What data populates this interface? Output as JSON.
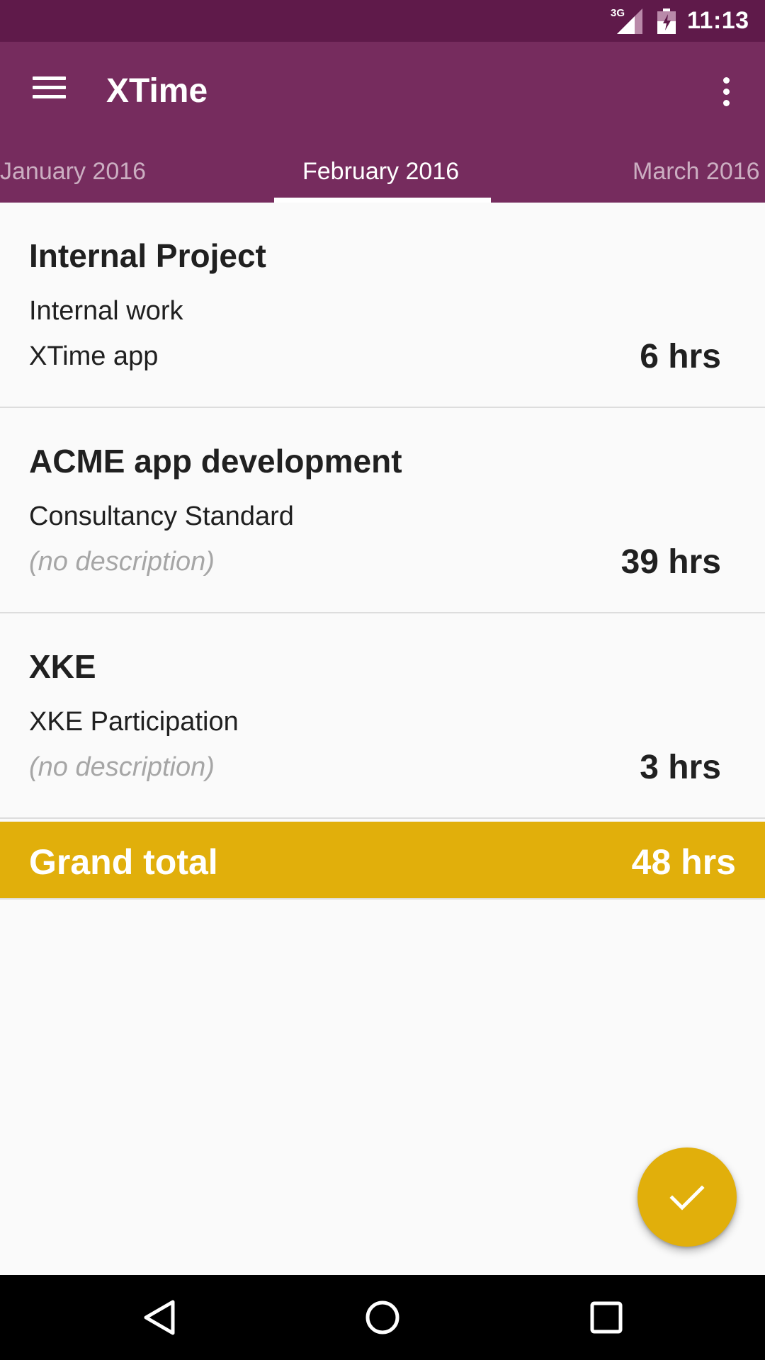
{
  "status_bar": {
    "network_label": "3G",
    "time": "11:13",
    "icons": [
      "signal-icon",
      "battery-charging-icon"
    ]
  },
  "app_bar": {
    "title": "XTime",
    "menu_icon": "hamburger-menu-icon",
    "overflow_icon": "more-vert-icon",
    "background_color": "#762c5e"
  },
  "tabs": [
    {
      "label": "January 2016",
      "active": false
    },
    {
      "label": "February 2016",
      "active": true
    },
    {
      "label": "March 2016",
      "active": false
    }
  ],
  "entries": [
    {
      "project": "Internal Project",
      "activity": "Internal work",
      "description": "XTime app",
      "description_empty": false,
      "hours": "6 hrs"
    },
    {
      "project": "ACME app development",
      "activity": "Consultancy Standard",
      "description": "(no description)",
      "description_empty": true,
      "hours": "39 hrs"
    },
    {
      "project": "XKE",
      "activity": "XKE Participation",
      "description": "(no description)",
      "description_empty": true,
      "hours": "3 hrs"
    }
  ],
  "grand_total": {
    "label": "Grand total",
    "value": "48 hrs",
    "color": "#e1af0b"
  },
  "fab": {
    "icon": "check-icon",
    "color": "#e1af0b"
  },
  "nav_bar": {
    "icons": [
      "back-icon",
      "home-icon",
      "recents-icon"
    ]
  }
}
